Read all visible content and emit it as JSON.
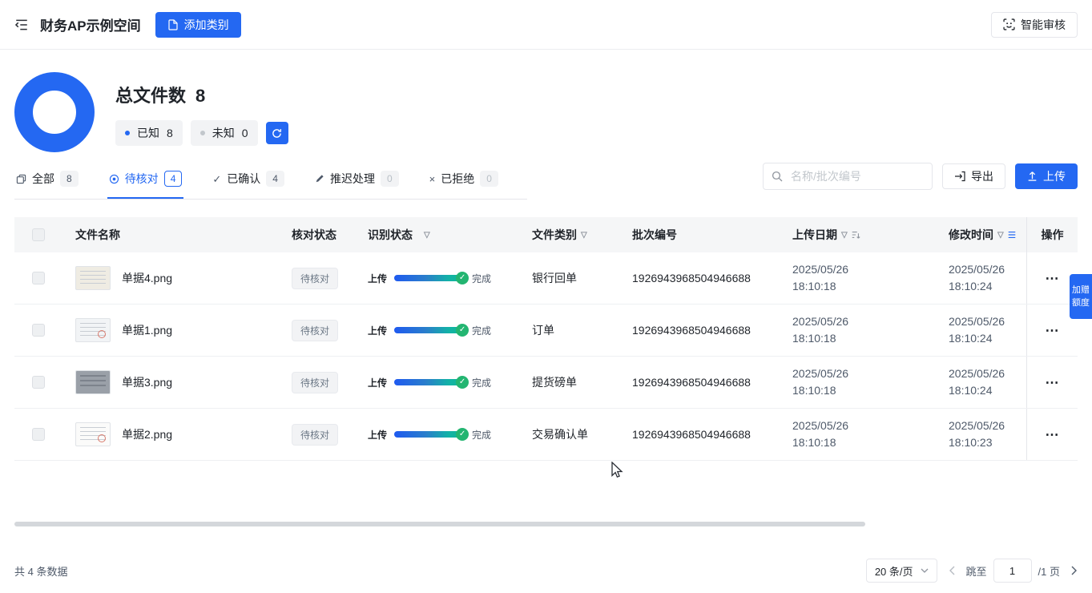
{
  "header": {
    "title": "财务AP示例空间",
    "add_category_label": "添加类别",
    "smart_review_label": "智能审核"
  },
  "stats": {
    "total_label": "总文件数",
    "total_value": "8",
    "known": {
      "label": "已知",
      "value": "8"
    },
    "unknown": {
      "label": "未知",
      "value": "0"
    }
  },
  "tabs": [
    {
      "label": "全部",
      "count": "8"
    },
    {
      "label": "待核对",
      "count": "4"
    },
    {
      "label": "已确认",
      "count": "4"
    },
    {
      "label": "推迟处理",
      "count": "0"
    },
    {
      "label": "已拒绝",
      "count": "0"
    }
  ],
  "toolbar": {
    "search_placeholder": "名称/批次编号",
    "export_label": "导出",
    "upload_label": "上传"
  },
  "table": {
    "headers": {
      "file_name": "文件名称",
      "check_status": "核对状态",
      "recognize_status": "识别状态",
      "file_category": "文件类别",
      "batch_no": "批次编号",
      "upload_date": "上传日期",
      "modify_time": "修改时间",
      "actions": "操作"
    },
    "progress_prefix": "上传",
    "progress_done": "完成",
    "rows": [
      {
        "name": "单据4.png",
        "status": "待核对",
        "category": "银行回单",
        "batch": "1926943968504946688",
        "upload_date": "2025/05/26",
        "upload_time": "18:10:18",
        "modified_date": "2025/05/26",
        "modified_time": "18:10:24"
      },
      {
        "name": "单据1.png",
        "status": "待核对",
        "category": "订单",
        "batch": "1926943968504946688",
        "upload_date": "2025/05/26",
        "upload_time": "18:10:18",
        "modified_date": "2025/05/26",
        "modified_time": "18:10:24"
      },
      {
        "name": "单据3.png",
        "status": "待核对",
        "category": "提货磅单",
        "batch": "1926943968504946688",
        "upload_date": "2025/05/26",
        "upload_time": "18:10:18",
        "modified_date": "2025/05/26",
        "modified_time": "18:10:24"
      },
      {
        "name": "单据2.png",
        "status": "待核对",
        "category": "交易确认单",
        "batch": "1926943968504946688",
        "upload_date": "2025/05/26",
        "upload_time": "18:10:18",
        "modified_date": "2025/05/26",
        "modified_time": "18:10:23"
      }
    ]
  },
  "side_tab_label": "加赠额度",
  "footer": {
    "total_text": "共 4 条数据",
    "page_size": "20 条/页",
    "jump_label": "跳至",
    "jump_value": "1",
    "page_total": "/1 页"
  },
  "colors": {
    "primary": "#2468F2",
    "success": "#23b571"
  }
}
